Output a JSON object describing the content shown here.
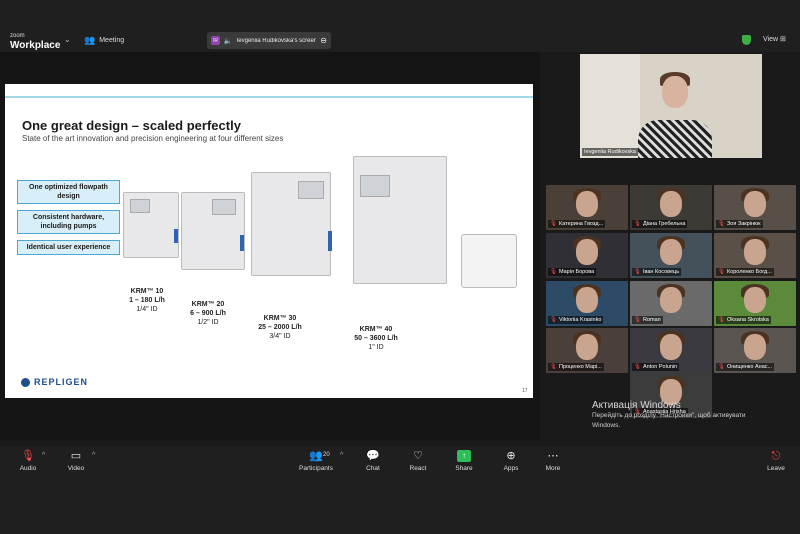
{
  "topbar": {
    "logo_line1": "zoom",
    "logo_line2": "Workplace",
    "meeting_label": "Meeting",
    "share_badge": "IR",
    "share_label": "Ievgeniia Rudikovska's screen",
    "view_label": "View"
  },
  "slide": {
    "title": "One great design – scaled perfectly",
    "subtitle": "State of the art innovation and precision engineering at four different sizes",
    "features": [
      "One optimized flowpath design",
      "Consistent hardware, including pumps",
      "Identical user experience"
    ],
    "specs": [
      {
        "name": "KRM™ 10",
        "range": "1 – 180 L/h",
        "id": "1/4\" ID"
      },
      {
        "name": "KRM™ 20",
        "range": "6 – 900 L/h",
        "id": "1/2\" ID"
      },
      {
        "name": "KRM™ 30",
        "range": "25 – 2000 L/h",
        "id": "3/4\" ID"
      },
      {
        "name": "KRM™ 40",
        "range": "50 – 3600 L/h",
        "id": "1\" ID"
      }
    ],
    "brand": "REPLIGEN",
    "page_number": "17"
  },
  "speaker": {
    "name": "Ievgeniia Rudikovska"
  },
  "participants": [
    {
      "name": "Катерина Гвозд...",
      "muted": true
    },
    {
      "name": "Діана Гребельна",
      "muted": true
    },
    {
      "name": "Зоя Закрінюк",
      "muted": true
    },
    {
      "name": "Марія Борова",
      "muted": true
    },
    {
      "name": "Іван Косовець",
      "muted": true
    },
    {
      "name": "Короленко Богд...",
      "muted": true
    },
    {
      "name": "Viktoriia Krasinko",
      "muted": true
    },
    {
      "name": "Roman",
      "muted": true
    },
    {
      "name": "Oksana Skrotska",
      "muted": true
    },
    {
      "name": "Проценко Марі...",
      "muted": true
    },
    {
      "name": "Anton Polunin",
      "muted": true
    },
    {
      "name": "Онищенко Анас...",
      "muted": true
    },
    {
      "name": "Anastasiia Hrisha",
      "muted": true
    }
  ],
  "watermark": {
    "title": "Активація Windows",
    "line1": "Перейдіть до розділу \"Настройки\", щоб активувати",
    "line2": "Windows."
  },
  "toolbar": {
    "audio": "Audio",
    "video": "Video",
    "participants": "Participants",
    "participants_count": "20",
    "chat": "Chat",
    "react": "React",
    "share": "Share",
    "apps": "Apps",
    "more": "More",
    "leave": "Leave"
  },
  "colors": {
    "share_green": "#2fbd59",
    "muted_red": "#ff4d4d",
    "slide_accent": "#4aa8d8",
    "brand_blue": "#1e4e8c"
  }
}
